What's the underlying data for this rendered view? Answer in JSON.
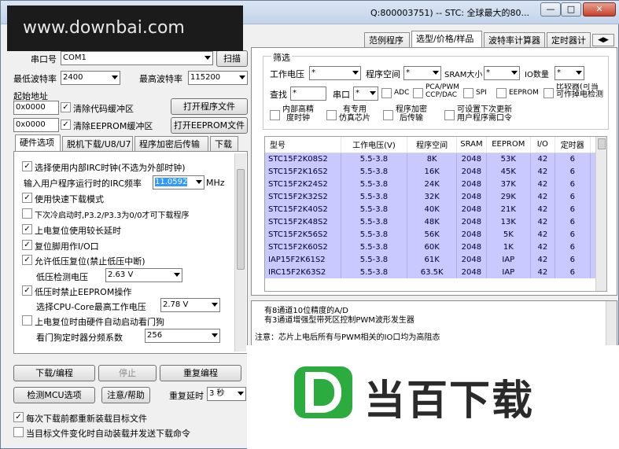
{
  "title_bar": {
    "text": "Q:800003751)  -- STC: 全球最大的80...",
    "min": "—",
    "max": "□",
    "close": "✕"
  },
  "watermark": "www.downbai.com",
  "left": {
    "port_label": "串口号",
    "port_value": "COM1",
    "scan": "扫描",
    "min_baud_label": "最低波特率",
    "min_baud_value": "2400",
    "max_baud_label": "最高波特率",
    "max_baud_value": "115200",
    "start_addr_label": "起始地址",
    "addr1": "0x0000",
    "clear_code": "清除代码缓冲区",
    "open_prog": "打开程序文件",
    "addr2": "0x0000",
    "clear_eeprom": "清除EEPROM缓冲区",
    "open_eeprom": "打开EEPROM文件",
    "tabs": [
      "硬件选项",
      "脱机下载/U8/U7",
      "程序加密后传输",
      "下载"
    ],
    "options": {
      "opt1": "选择使用内部IRC时钟(不选为外部时钟)",
      "freq_label": "输入用户程序运行时的IRC频率",
      "freq_value": "11.0592",
      "freq_unit": "MHz",
      "opt2": "使用快速下载模式",
      "opt3": "下次冷启动时,P3.2/P3.3为0/0才可下载程序",
      "opt4": "上电复位使用较长延时",
      "opt5": "复位脚用作I/O口",
      "opt6": "允许低压复位(禁止低压中断)",
      "lv_label": "低压检测电压",
      "lv_value": "2.63 V",
      "opt7": "低压时禁止EEPROM操作",
      "cpu_label": "选择CPU-Core最高工作电压",
      "cpu_value": "2.78 V",
      "opt8": "上电复位时由硬件自动启动看门狗",
      "wdt_label": "看门狗定时器分频系数",
      "wdt_value": "256"
    },
    "download": "下载/编程",
    "stop": "停止",
    "reprogram": "重复编程",
    "detect": "检测MCU选项",
    "help": "注意/帮助",
    "repeat_delay_label": "重复延时",
    "repeat_delay_value": "3 秒",
    "reload": "每次下载前都重新装载目标文件",
    "auto_send": "当目标文件变化时自动装载并发送下载命令"
  },
  "right": {
    "tabs": [
      "范例程序",
      "选型/价格/样品",
      "波特率计算器",
      "定时器计"
    ],
    "filter_title": "筛选",
    "voltage_label": "工作电压",
    "voltage_value": "*",
    "space_label": "程序空间",
    "space_value": "*",
    "sram_label": "SRAM大小",
    "sram_value": "*",
    "io_label": "IO数量",
    "io_value": "*",
    "search_label": "查找",
    "search_value": "*",
    "uart_label": "串口",
    "uart_value": "*",
    "adc": "ADC",
    "pca": "PCA/PWM\nCCP/DAC",
    "spi": "SPI",
    "eeprom": "EEPROM",
    "comparator": "比较器(可当\n可作掉电检测",
    "irc": "内部高精\n度时钟",
    "usb": "有专用\n仿真芯片",
    "encrypt": "程序加密\n后传输",
    "settable": "可设置下次更新\n用户程序需口令",
    "headers": [
      "型号",
      "工作电压(V)",
      "程序空间",
      "SRAM",
      "EEPROM",
      "I/O",
      "定时器",
      "串"
    ],
    "rows": [
      [
        "STC15F2K08S2",
        "5.5-3.8",
        "8K",
        "2048",
        "53K",
        "42",
        "6"
      ],
      [
        "STC15F2K16S2",
        "5.5-3.8",
        "16K",
        "2048",
        "45K",
        "42",
        "6"
      ],
      [
        "STC15F2K24S2",
        "5.5-3.8",
        "24K",
        "2048",
        "37K",
        "42",
        "6"
      ],
      [
        "STC15F2K32S2",
        "5.5-3.8",
        "32K",
        "2048",
        "29K",
        "42",
        "6"
      ],
      [
        "STC15F2K40S2",
        "5.5-3.8",
        "40K",
        "2048",
        "21K",
        "42",
        "6"
      ],
      [
        "STC15F2K48S2",
        "5.5-3.8",
        "48K",
        "2048",
        "13K",
        "42",
        "6"
      ],
      [
        "STC15F2K56S2",
        "5.5-3.8",
        "56K",
        "2048",
        "5K",
        "42",
        "6"
      ],
      [
        "STC15F2K60S2",
        "5.5-3.8",
        "60K",
        "2048",
        "1K",
        "42",
        "6"
      ],
      [
        "IAP15F2K61S2",
        "5.5-3.8",
        "61K",
        "2048",
        "IAP",
        "42",
        "6"
      ],
      [
        "IRC15F2K63S2",
        "5.5-3.8",
        "63.5K",
        "2048",
        "IAP",
        "42",
        "6"
      ]
    ],
    "info_line1": "有8通道10位精度的A/D",
    "info_line2": "有3通道增强型带死区控制PWM波形发生器",
    "info_line3": "注意：芯片上电后所有与PWM相关的IO口均为高阻态"
  },
  "logo_text": "当百下载",
  "colors": {
    "selection": "#c9c8ff",
    "logo_green": "#2cab3f",
    "freq_highlight": "#3399ff"
  }
}
